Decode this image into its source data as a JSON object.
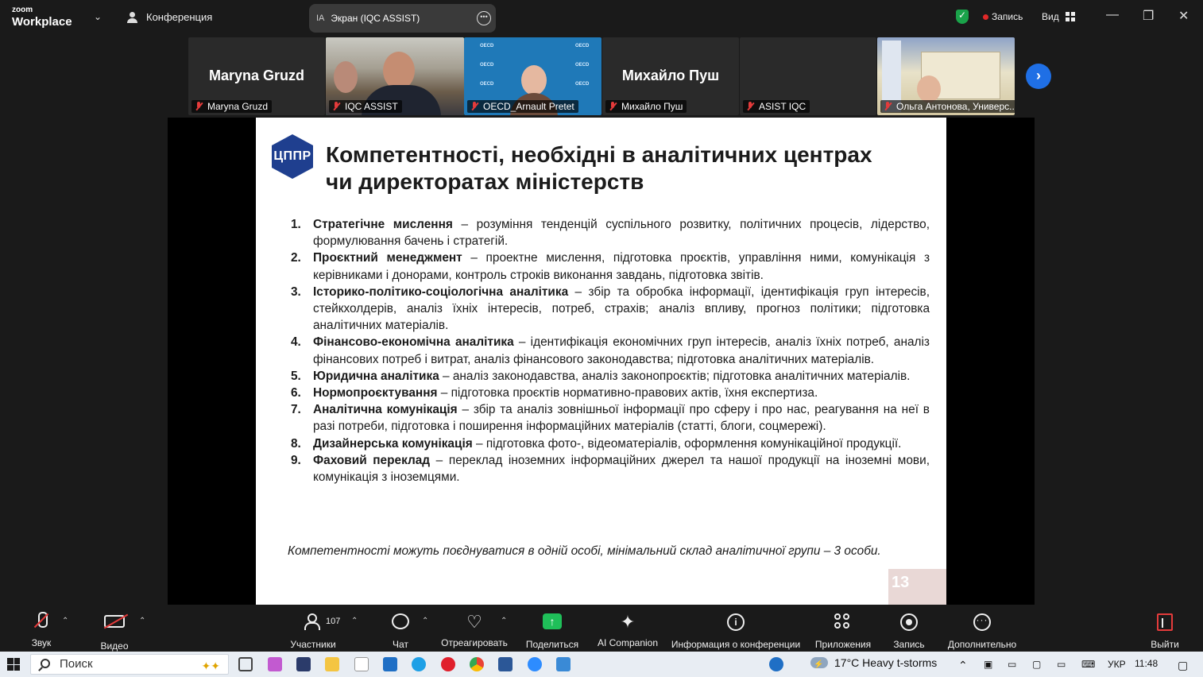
{
  "titlebar": {
    "brand_small": "zoom",
    "brand_big": "Workplace",
    "conference_label": "Конференция",
    "screen_badge": "IA",
    "screen_title": "Экран (IQC ASSIST)",
    "record_label": "Запись",
    "view_label": "Вид"
  },
  "participants": [
    {
      "bigname": "Maryna Gruzd",
      "label": "Maryna Gruzd"
    },
    {
      "bigname": "",
      "label": "IQC ASSIST"
    },
    {
      "bigname": "",
      "label": "OECD_Arnault Pretet",
      "oecd": "OECD"
    },
    {
      "bigname": "Михайло Пуш",
      "label": "Михайло Пуш"
    },
    {
      "bigname": "",
      "label": "ASIST IQC"
    },
    {
      "bigname": "",
      "label": "Ольга Антонова, Универс..."
    }
  ],
  "slide": {
    "logo": "ЦППР",
    "title_line1": "Компетентності, необхідні в аналітичних центрах",
    "title_line2": "чи директоратах міністерств",
    "items": [
      {
        "num": "1.",
        "head": "Стратегічне мислення",
        "text": " – розуміння тенденцій суспільного розвитку, політичних процесів, лідерство, формулювання бачень і стратегій."
      },
      {
        "num": "2.",
        "head": "Проєктний менеджмент",
        "text": " – проектне мислення, підготовка проєктів, управління ними, комунікація з керівниками і донорами, контроль строків виконання завдань, підготовка звітів."
      },
      {
        "num": "3.",
        "head": "Історико-політико-соціологічна аналітика",
        "text": " – збір та обробка інформації, ідентифікація груп інтересів, стейкхолдерів, аналіз їхніх інтересів, потреб, страхів; аналіз впливу, прогноз політики; підготовка аналітичних матеріалів."
      },
      {
        "num": "4.",
        "head": "Фінансово-економічна аналітика",
        "text": " – ідентифікація економічних груп інтересів, аналіз їхніх потреб, аналіз фінансових потреб і витрат, аналіз фінансового законодавства; підготовка аналітичних матеріалів."
      },
      {
        "num": "5.",
        "head": "Юридична аналітика",
        "text": " – аналіз законодавства, аналіз законопроєктів; підготовка аналітичних матеріалів."
      },
      {
        "num": "6.",
        "head": "Нормопроєктування",
        "text": " – підготовка проєктів нормативно-правових актів, їхня експертиза."
      },
      {
        "num": "7.",
        "head": "Аналітична комунікація",
        "text": " – збір та аналіз зовнішньої інформації про сферу і про нас, реагування на неї в разі потреби, підготовка і поширення інформаційних матеріалів (статті, блоги, соцмережі)."
      },
      {
        "num": "8.",
        "head": "Дизайнерська комунікація",
        "text": " – підготовка фото-, відеоматеріалів, оформлення комунікаційної продукції."
      },
      {
        "num": "9.",
        "head": "Фаховий переклад",
        "text": " – переклад іноземних інформаційних джерел та нашої продукції на іноземні мови, комунікація з іноземцями."
      }
    ],
    "note": "Компетентності можуть поєднуватися в одній особі, мінімальний склад аналітичної групи – 3 особи.",
    "page": "13"
  },
  "toolbar": {
    "audio": "Звук",
    "video": "Видео",
    "participants": "Участники",
    "participants_count": "107",
    "chat": "Чат",
    "react": "Отреагировать",
    "share": "Поделиться",
    "ai": "AI Companion",
    "info": "Информация о конференции",
    "apps": "Приложения",
    "record": "Запись",
    "more": "Дополнительно",
    "leave": "Выйти"
  },
  "taskbar": {
    "search": "Поиск",
    "weather": "17°C  Heavy t-storms",
    "lang": "УКР",
    "time": "11:48"
  }
}
